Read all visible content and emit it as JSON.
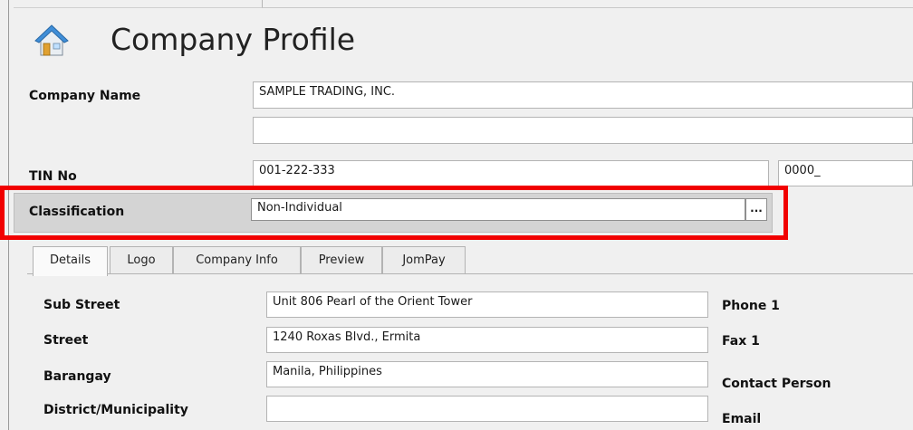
{
  "header": {
    "title": "Company Profile",
    "icon": "house-icon"
  },
  "form": {
    "company_name_label": "Company Name",
    "company_name_value": "SAMPLE TRADING, INC.",
    "company_name_line2": "",
    "tin_label": "TIN No",
    "tin_value": "001-222-333",
    "tin_branch_value": "0000_",
    "classification_label": "Classification",
    "classification_value": "Non-Individual",
    "classification_button": "..."
  },
  "tabs": [
    {
      "label": "Details",
      "active": true
    },
    {
      "label": "Logo"
    },
    {
      "label": "Company Info"
    },
    {
      "label": "Preview"
    },
    {
      "label": "JomPay"
    }
  ],
  "details": {
    "sub_street_label": "Sub Street",
    "sub_street_value": "Unit 806 Pearl of the Orient Tower",
    "street_label": "Street",
    "street_value": "1240 Roxas Blvd., Ermita",
    "barangay_label": "Barangay",
    "barangay_value": "Manila, Philippines",
    "district_label": "District/Municipality",
    "district_value": "",
    "phone1_label": "Phone 1",
    "fax1_label": "Fax 1",
    "contact_label": "Contact Person",
    "email_label": "Email"
  },
  "colors": {
    "highlight": "#f10000",
    "bar": "#d4d4d4"
  }
}
